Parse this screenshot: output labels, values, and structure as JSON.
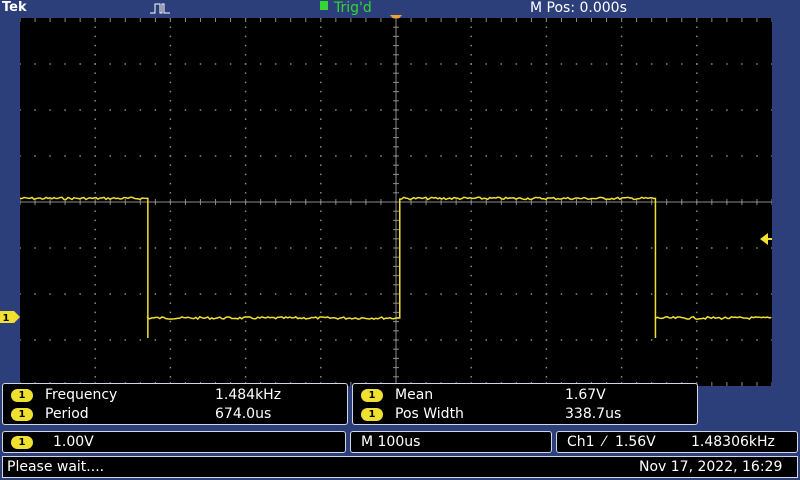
{
  "topbar": {
    "brand": "Tek",
    "acquire_icon": "run-pulse-icon",
    "trigger_status": "Trig'd",
    "horizontal_position": "M Pos: 0.000s"
  },
  "colors": {
    "background": "#2c3f7a",
    "graticule_bg": "#000000",
    "grid": "#8a8a8a",
    "channel1": "#f0e130",
    "trigger_marker": "#f0a030",
    "trig_status": "#33d633"
  },
  "waveform": {
    "channel": "1",
    "shape": "square",
    "segments": [
      {
        "from_div": 0.0,
        "to_div": 1.7,
        "level": "high"
      },
      {
        "from_div": 1.7,
        "to_div": 5.05,
        "level": "low"
      },
      {
        "from_div": 5.05,
        "to_div": 8.45,
        "level": "high"
      },
      {
        "from_div": 8.45,
        "to_div": 10.0,
        "level": "low"
      }
    ],
    "high_div": 2.6,
    "low_div": 0.0
  },
  "measurements_left": [
    {
      "channel": "1",
      "name": "Frequency",
      "value": "1.484kHz"
    },
    {
      "channel": "1",
      "name": "Period",
      "value": "674.0us"
    }
  ],
  "measurements_right": [
    {
      "channel": "1",
      "name": "Mean",
      "value": "1.67V"
    },
    {
      "channel": "1",
      "name": "Pos Width",
      "value": "338.7us"
    }
  ],
  "status": {
    "ch1_badge": "1",
    "ch1_scale": "1.00V",
    "timebase": "M 100us",
    "trigger_source": "Ch1",
    "trigger_slope": "⁄",
    "trigger_level": "1.56V",
    "trigger_frequency": "1.48306kHz"
  },
  "footer": {
    "message": "Please wait....",
    "datetime": "Nov 17, 2022, 16:29"
  },
  "markers": {
    "ch1_ground": "1",
    "trigger_position": "T"
  }
}
